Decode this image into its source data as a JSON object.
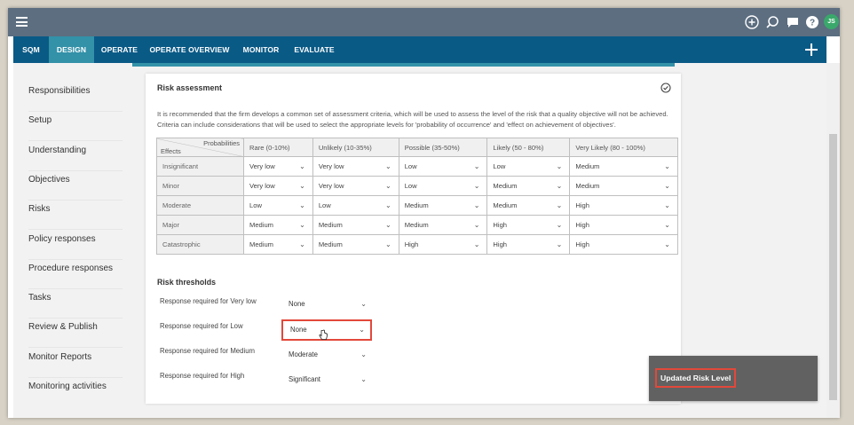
{
  "topbar": {
    "avatar_initials": "JS",
    "icons": [
      "menu-icon",
      "add-circle-icon",
      "search-icon",
      "chat-icon",
      "help-icon"
    ]
  },
  "nav": {
    "items": [
      "SQM",
      "DESIGN",
      "OPERATE",
      "OPERATE OVERVIEW",
      "MONITOR",
      "EVALUATE"
    ],
    "active": "DESIGN",
    "active_color": "#3391a8",
    "bar_color": "#0a5a86"
  },
  "sidebar": {
    "items": [
      "Responsibilities",
      "Setup",
      "Understanding",
      "Objectives",
      "Risks",
      "Policy responses",
      "Procedure responses",
      "Tasks",
      "Review & Publish",
      "Monitor Reports",
      "Monitoring activities"
    ]
  },
  "card": {
    "title": "Risk assessment",
    "description": "It is recommended that the firm develops a common set of assessment criteria, which will be used to assess the level of the risk that a quality objective will not be achieved. Criteria can include considerations that will be used to select the appropriate levels for 'probability of occurrence' and 'effect on achievement of objectives'.",
    "matrix": {
      "corner_top": "Probabilities",
      "corner_bottom": "Effects",
      "columns": [
        "Rare (0-10%)",
        "Unlikely (10-35%)",
        "Possible (35-50%)",
        "Likely (50 - 80%)",
        "Very Likely (80 - 100%)"
      ],
      "rows": [
        {
          "label": "Insignificant",
          "values": [
            "Very low",
            "Very low",
            "Low",
            "Low",
            "Medium"
          ]
        },
        {
          "label": "Minor",
          "values": [
            "Very low",
            "Very low",
            "Low",
            "Medium",
            "Medium"
          ]
        },
        {
          "label": "Moderate",
          "values": [
            "Low",
            "Low",
            "Medium",
            "Medium",
            "High"
          ]
        },
        {
          "label": "Major",
          "values": [
            "Medium",
            "Medium",
            "Medium",
            "High",
            "High"
          ]
        },
        {
          "label": "Catastrophic",
          "values": [
            "Medium",
            "Medium",
            "High",
            "High",
            "High"
          ]
        }
      ]
    },
    "thresholds": {
      "title": "Risk thresholds",
      "items": [
        {
          "label": "Response required for Very low",
          "value": "None"
        },
        {
          "label": "Response required for Low",
          "value": "None"
        },
        {
          "label": "Response required for Medium",
          "value": "Moderate"
        },
        {
          "label": "Response required for High",
          "value": "Significant"
        }
      ]
    }
  },
  "toast": {
    "text": "Updated Risk Level"
  },
  "highlight_color": "#e2483a"
}
